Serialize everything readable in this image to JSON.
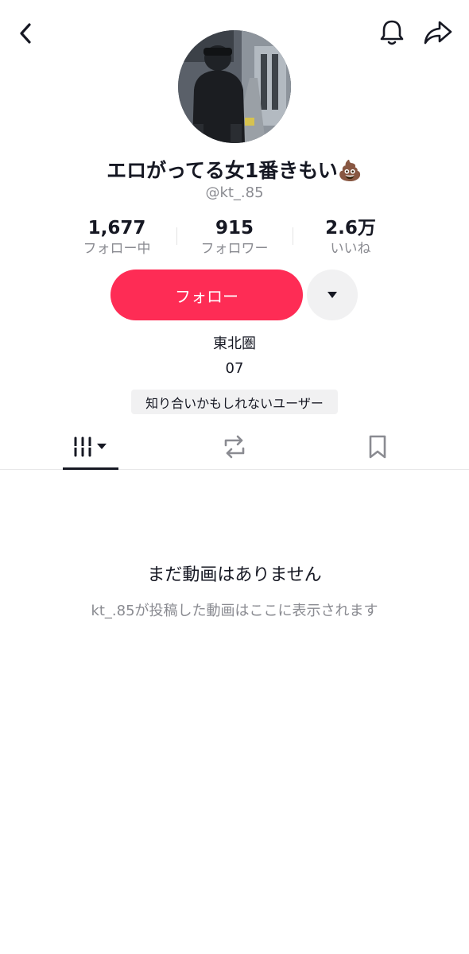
{
  "header": {
    "back_icon": "chevron-left-icon",
    "bell_icon": "bell-icon",
    "share_icon": "share-arrow-icon"
  },
  "profile": {
    "display_name": "エロがってる女1番きもい💩",
    "handle": "@kt_.85"
  },
  "stats": [
    {
      "value": "1,677",
      "label": "フォロー中"
    },
    {
      "value": "915",
      "label": "フォロワー"
    },
    {
      "value": "2.6万",
      "label": "いいね"
    }
  ],
  "actions": {
    "follow_label": "フォロー",
    "more_icon": "caret-down-icon"
  },
  "bio": {
    "line1": "東北圏",
    "line2": "07"
  },
  "suggestion_chip": "知り合いかもしれないユーザー",
  "tabs": [
    {
      "icon": "videos-grid-icon",
      "selected": true
    },
    {
      "icon": "repost-icon",
      "selected": false
    },
    {
      "icon": "bookmark-icon",
      "selected": false
    }
  ],
  "empty_state": {
    "title": "まだ動画はありません",
    "subtitle": "kt_.85が投稿した動画はここに表示されます"
  },
  "colors": {
    "accent": "#fe2c55",
    "text_primary": "#161823",
    "text_secondary": "#8a8b91",
    "chip_bg": "#f1f1f2"
  }
}
